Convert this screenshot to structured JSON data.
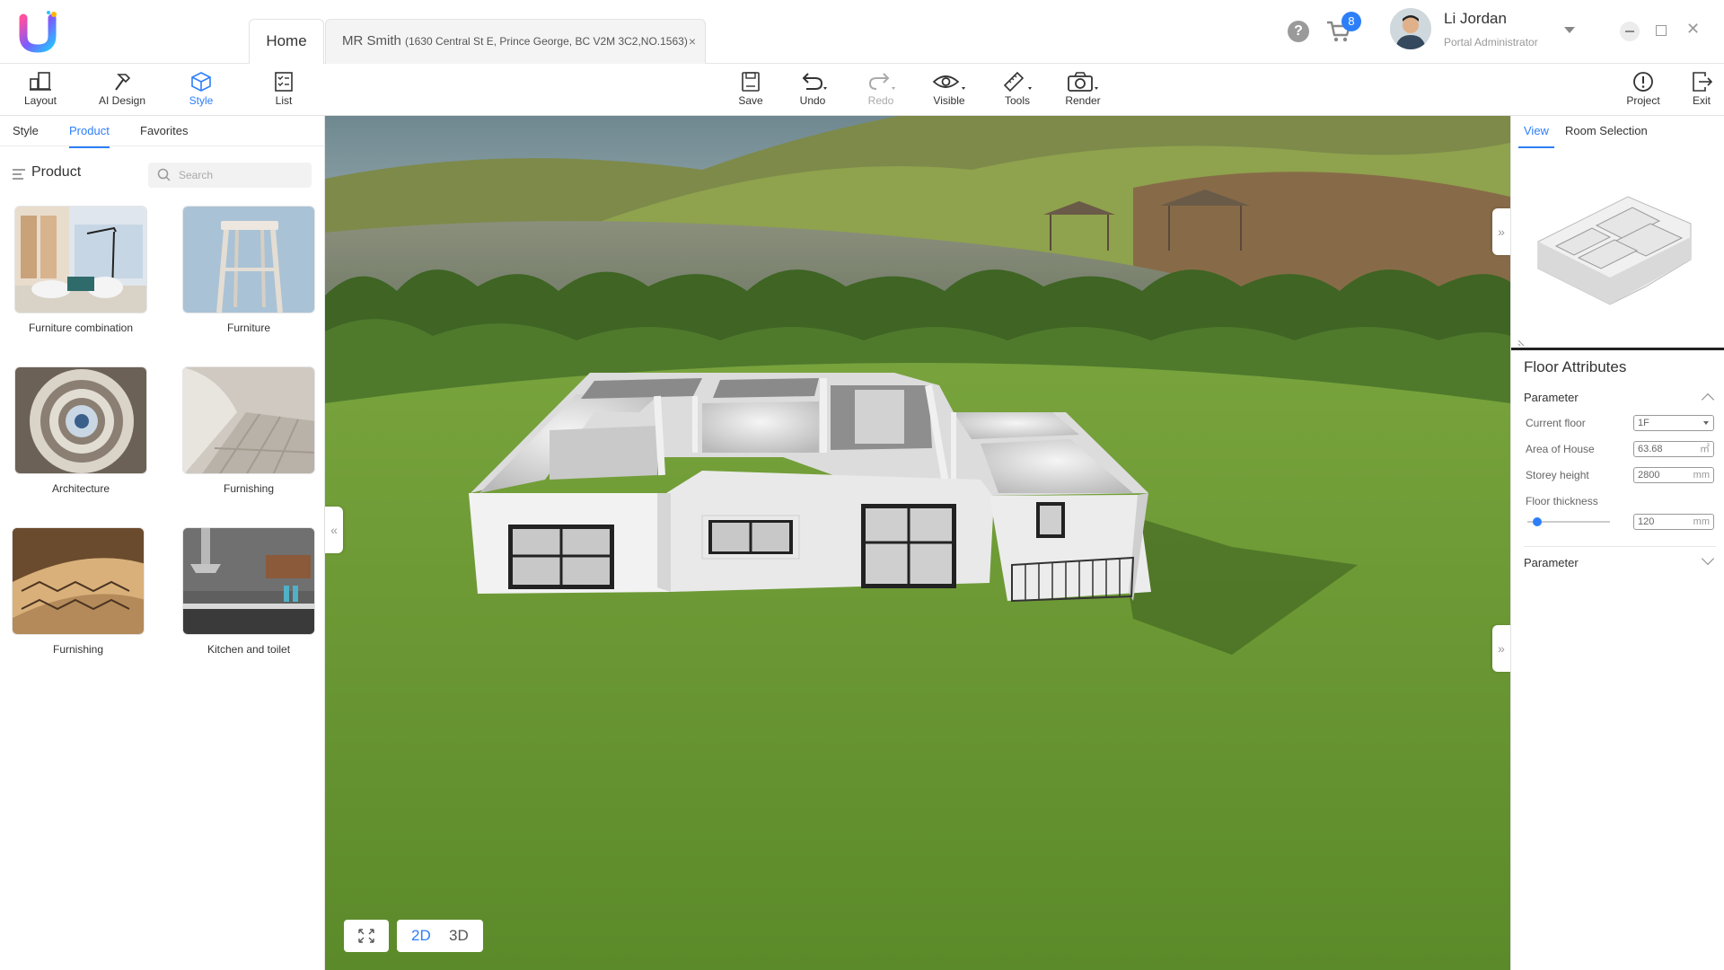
{
  "header": {
    "tabs": {
      "home": "Home",
      "project_name": "MR Smith",
      "project_address": "(1630 Central St E, Prince George, BC V2M 3C2,NO.1563)",
      "close": "×"
    },
    "help": "?",
    "cart_count": "8",
    "user": {
      "name": "Li Jordan",
      "role": "Portal Administrator"
    },
    "window": {
      "close": "✕"
    }
  },
  "toolbar": {
    "left": [
      {
        "label": "Layout",
        "icon": "layout-icon"
      },
      {
        "label": "AI Design",
        "icon": "hammer-icon"
      },
      {
        "label": "Style",
        "icon": "cube-icon",
        "active": true
      },
      {
        "label": "List",
        "icon": "checklist-icon"
      }
    ],
    "center": [
      {
        "label": "Save",
        "icon": "save-icon"
      },
      {
        "label": "Undo",
        "icon": "undo-icon"
      },
      {
        "label": "Redo",
        "icon": "redo-icon",
        "disabled": true
      },
      {
        "label": "Visible",
        "icon": "eye-icon"
      },
      {
        "label": "Tools",
        "icon": "ruler-icon"
      },
      {
        "label": "Render",
        "icon": "camera-icon"
      }
    ],
    "right": [
      {
        "label": "Project",
        "icon": "info-icon"
      },
      {
        "label": "Exit",
        "icon": "exit-icon"
      }
    ]
  },
  "leftpanel": {
    "tabs": [
      "Style",
      "Product",
      "Favorites"
    ],
    "active_tab": "Product",
    "heading": "Product",
    "search_placeholder": "Search",
    "categories": [
      "Furniture combination",
      "Furniture",
      "Architecture",
      "Furnishing",
      "Furnishing",
      "Kitchen and toilet"
    ]
  },
  "viewport": {
    "view_2d": "2D",
    "view_3d": "3D",
    "collapse_left": "«",
    "collapse_right": "»"
  },
  "rightpanel": {
    "tabs": [
      "View",
      "Room Selection"
    ],
    "active_tab": "View",
    "title": "Floor Attributes",
    "section1": "Parameter",
    "section2": "Parameter",
    "fields": {
      "current_floor": {
        "label": "Current floor",
        "value": "1F"
      },
      "area": {
        "label": "Area of House",
        "value": "63.68",
        "unit": "㎡"
      },
      "storey_height": {
        "label": "Storey height",
        "value": "2800",
        "unit": "mm"
      },
      "floor_thickness": {
        "label": "Floor thickness",
        "value": "120",
        "unit": "mm"
      }
    },
    "floor_thickness_slider_fraction": 0.12
  },
  "colors": {
    "accent": "#2d7ff9",
    "grass": "#5f8f2c",
    "wall": "#f2f2f2"
  }
}
